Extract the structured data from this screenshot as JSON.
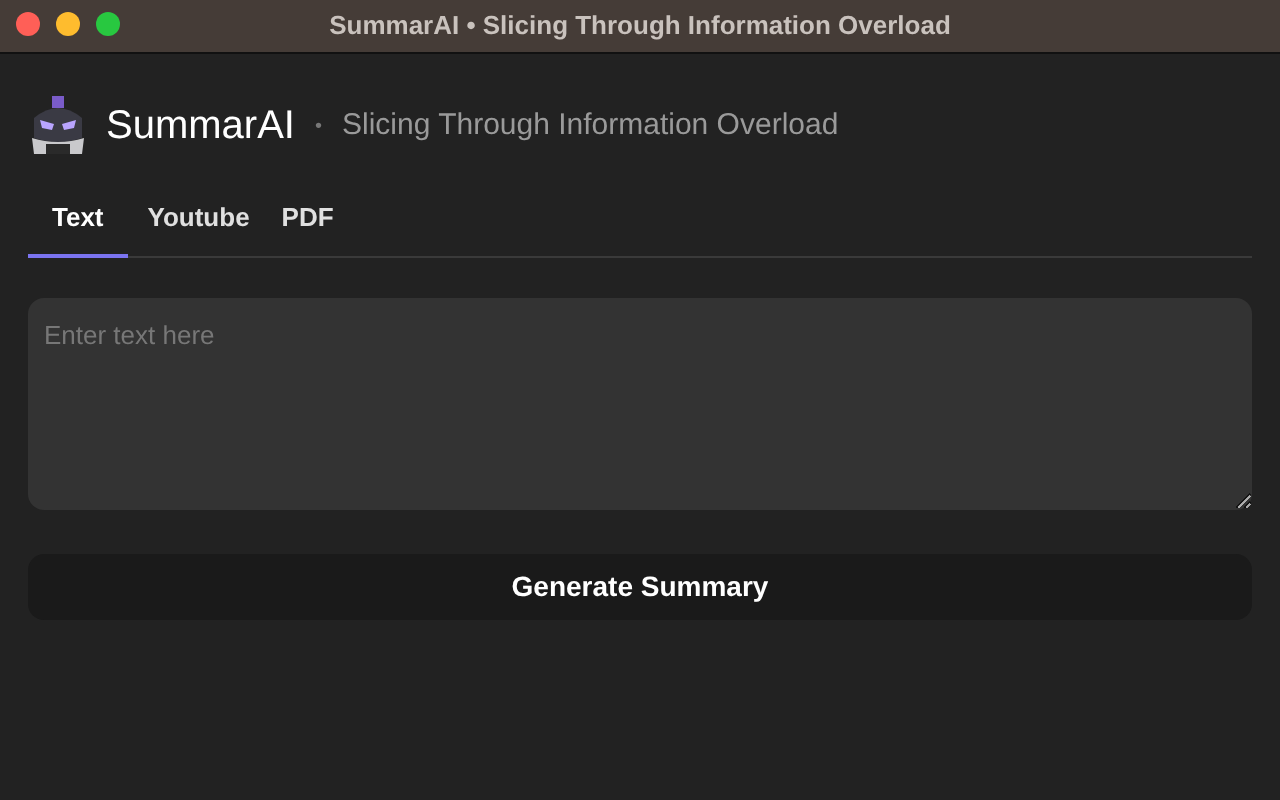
{
  "window": {
    "title": "SummarAI • Slicing Through Information Overload"
  },
  "header": {
    "app_name": "SummarAI",
    "separator": "•",
    "tagline": "Slicing Through Information Overload"
  },
  "tabs": [
    {
      "label": "Text",
      "selected": true
    },
    {
      "label": "Youtube",
      "selected": false
    },
    {
      "label": "PDF",
      "selected": false
    }
  ],
  "input": {
    "placeholder": "Enter text here"
  },
  "button": {
    "label": "Generate Summary"
  }
}
